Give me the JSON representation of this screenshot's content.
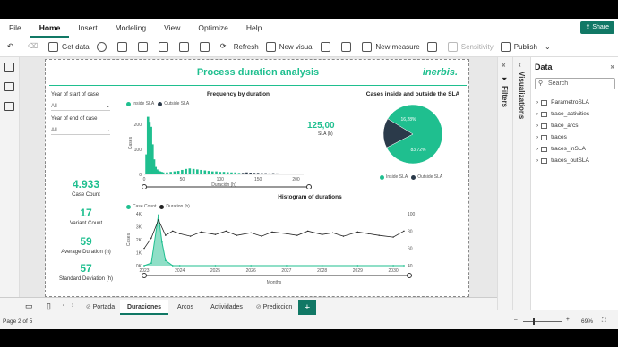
{
  "menu": [
    "File",
    "Home",
    "Insert",
    "Modeling",
    "View",
    "Optimize",
    "Help"
  ],
  "share_label": "Share",
  "ribbon": {
    "get_data": "Get data",
    "refresh": "Refresh",
    "new_visual": "New visual",
    "new_measure": "New measure",
    "sensitivity": "Sensitivity",
    "publish": "Publish"
  },
  "report": {
    "title": "Process duration analysis",
    "logo": "inerbis."
  },
  "slicers": [
    {
      "label": "Year of start of case",
      "value": "All"
    },
    {
      "label": "Year of end of case",
      "value": "All"
    }
  ],
  "kpis": [
    {
      "value": "4.933",
      "label": "Case Count"
    },
    {
      "value": "17",
      "label": "Variant Count"
    },
    {
      "value": "59",
      "label": "Average Duration (h)"
    },
    {
      "value": "57",
      "label": "Standard Deviation (h)"
    }
  ],
  "freq": {
    "title": "Frequency by duration",
    "legend": [
      "Inside SLA",
      "Outside SLA"
    ],
    "ylabel": "Cases",
    "xlabel": "Duración (h)",
    "yticks": [
      "0",
      "100",
      "200"
    ],
    "xticks": [
      "0",
      "50",
      "100",
      "150",
      "200"
    ],
    "sla_value": "125,00",
    "sla_label": "SLA (h)"
  },
  "pie": {
    "title": "Cases inside and outside the SLA",
    "inside_pct": "83,72%",
    "outside_pct": "16,28%",
    "legend": [
      "Inside SLA",
      "Outside SLA"
    ]
  },
  "hist": {
    "title": "Histogram of durations",
    "legend": [
      "Case Count",
      "Duration (h)"
    ],
    "ylabel": "Cases",
    "xlabel": "Months",
    "y_left": [
      "0K",
      "1K",
      "2K",
      "3K",
      "4K"
    ],
    "y_right": [
      "40",
      "60",
      "80",
      "100"
    ],
    "x_ticks": [
      "2023",
      "2024",
      "2025",
      "2026",
      "2027",
      "2028",
      "2029",
      "2030"
    ]
  },
  "panes": {
    "filters": "Filters",
    "visualizations": "Visualizations",
    "data": "Data",
    "search_placeholder": "Search",
    "tables": [
      "ParametroSLA",
      "trace_activities",
      "trace_arcs",
      "traces",
      "traces_inSLA",
      "traces_outSLA"
    ]
  },
  "tabs": [
    "Portada",
    "Duraciones",
    "Arcos",
    "Actividades",
    "Prediccion"
  ],
  "status": {
    "page": "Page 2 of 5",
    "zoom": "69%"
  },
  "colors": {
    "accent": "#1fbf8f",
    "dark": "#2b3a4a",
    "brand": "#117865"
  },
  "chart_data": [
    {
      "type": "bar",
      "title": "Frequency by duration",
      "xlabel": "Duración (h)",
      "ylabel": "Cases",
      "ylim": [
        0,
        250
      ],
      "xlim": [
        0,
        210
      ],
      "series": [
        {
          "name": "Inside SLA",
          "x": [
            3,
            5,
            7,
            9,
            11,
            13,
            15,
            17,
            19,
            21,
            23,
            25,
            30,
            35,
            40,
            45,
            50,
            55,
            60,
            65,
            70,
            75,
            80,
            85,
            90,
            95,
            100,
            105,
            110,
            115,
            120,
            125
          ],
          "values": [
            80,
            230,
            210,
            190,
            120,
            60,
            30,
            20,
            15,
            12,
            10,
            8,
            8,
            10,
            12,
            14,
            18,
            22,
            24,
            22,
            20,
            18,
            16,
            14,
            12,
            12,
            10,
            10,
            9,
            8,
            8,
            6
          ]
        },
        {
          "name": "Outside SLA",
          "x": [
            130,
            135,
            140,
            145,
            150,
            155,
            160,
            165,
            170,
            175,
            180,
            185,
            190,
            195,
            200
          ],
          "values": [
            6,
            8,
            7,
            6,
            6,
            5,
            5,
            4,
            5,
            4,
            3,
            3,
            2,
            2,
            1
          ]
        }
      ]
    },
    {
      "type": "pie",
      "title": "Cases inside and outside the SLA",
      "categories": [
        "Inside SLA",
        "Outside SLA"
      ],
      "values": [
        83.72,
        16.28
      ]
    },
    {
      "type": "line",
      "title": "Histogram of durations",
      "xlabel": "Months",
      "ylabel": "Cases",
      "x_range": [
        "2023",
        "2030"
      ],
      "series": [
        {
          "name": "Case Count",
          "axis": "left",
          "ylim": [
            0,
            4000
          ],
          "x": [
            2023.0,
            2023.2,
            2023.4,
            2023.5,
            2023.6,
            2023.8,
            2024.0,
            2025.0,
            2026.0,
            2027.0,
            2028.0,
            2029.0,
            2030.0,
            2030.3
          ],
          "values": [
            0,
            200,
            3900,
            1800,
            400,
            0,
            0,
            0,
            0,
            0,
            0,
            0,
            0,
            0
          ]
        },
        {
          "name": "Duration (h)",
          "axis": "right",
          "ylim": [
            40,
            100
          ],
          "x": [
            2023.0,
            2023.2,
            2023.4,
            2023.6,
            2023.8,
            2024.0,
            2024.3,
            2024.6,
            2025.0,
            2025.3,
            2025.6,
            2026.0,
            2026.3,
            2026.6,
            2027.0,
            2027.3,
            2027.6,
            2028.0,
            2028.3,
            2028.6,
            2029.0,
            2029.3,
            2029.6,
            2030.0,
            2030.3
          ],
          "values": [
            60,
            72,
            93,
            75,
            80,
            77,
            74,
            79,
            76,
            80,
            75,
            78,
            74,
            79,
            77,
            75,
            80,
            76,
            78,
            74,
            79,
            77,
            75,
            73,
            80
          ]
        }
      ]
    }
  ]
}
